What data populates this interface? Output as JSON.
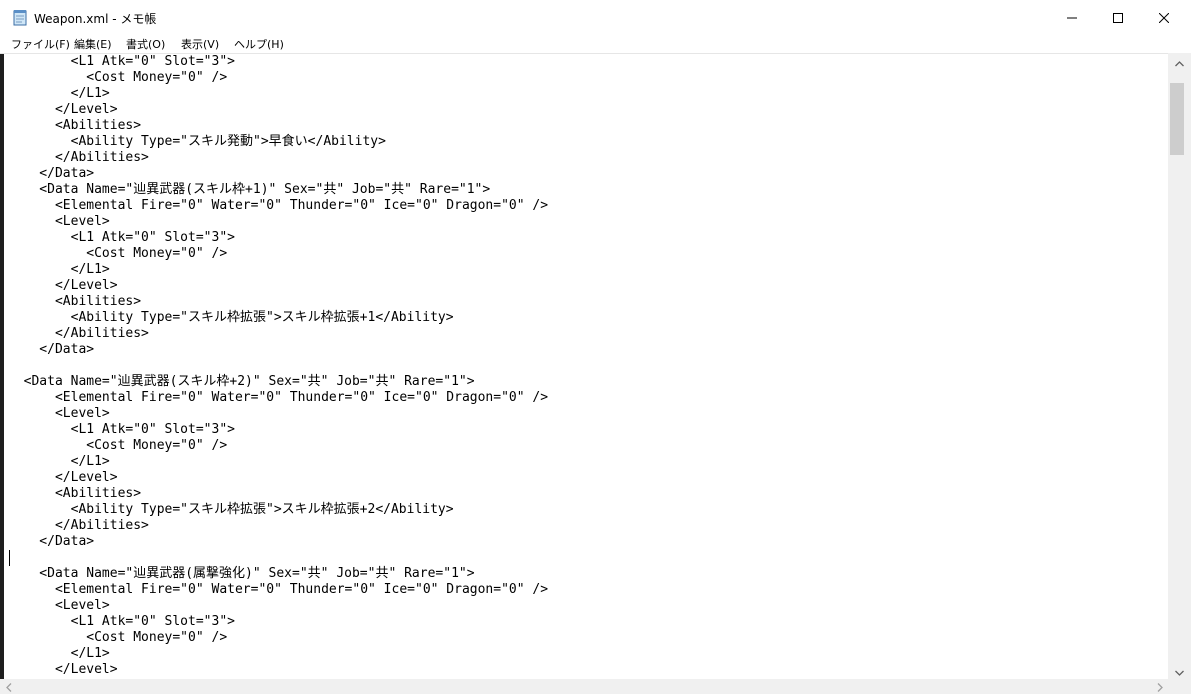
{
  "window": {
    "title": "Weapon.xml - メモ帳",
    "icon": "notepad-icon",
    "controls": {
      "minimize": "minimize-icon",
      "maximize": "maximize-icon",
      "close": "close-icon"
    }
  },
  "menu": {
    "file": "ファイル(F)",
    "edit": "編集(E)",
    "format": "書式(O)",
    "view": "表示(V)",
    "help": "ヘルプ(H)"
  },
  "editor": {
    "lines": [
      "        <L1 Atk=\"0\" Slot=\"3\">",
      "          <Cost Money=\"0\" />",
      "        </L1>",
      "      </Level>",
      "      <Abilities>",
      "        <Ability Type=\"スキル発動\">早食い</Ability>",
      "      </Abilities>",
      "    </Data>",
      "    <Data Name=\"辿異武器(スキル枠+1)\" Sex=\"共\" Job=\"共\" Rare=\"1\">",
      "      <Elemental Fire=\"0\" Water=\"0\" Thunder=\"0\" Ice=\"0\" Dragon=\"0\" />",
      "      <Level>",
      "        <L1 Atk=\"0\" Slot=\"3\">",
      "          <Cost Money=\"0\" />",
      "        </L1>",
      "      </Level>",
      "      <Abilities>",
      "        <Ability Type=\"スキル枠拡張\">スキル枠拡張+1</Ability>",
      "      </Abilities>",
      "    </Data>",
      "",
      "  <Data Name=\"辿異武器(スキル枠+2)\" Sex=\"共\" Job=\"共\" Rare=\"1\">",
      "      <Elemental Fire=\"0\" Water=\"0\" Thunder=\"0\" Ice=\"0\" Dragon=\"0\" />",
      "      <Level>",
      "        <L1 Atk=\"0\" Slot=\"3\">",
      "          <Cost Money=\"0\" />",
      "        </L1>",
      "      </Level>",
      "      <Abilities>",
      "        <Ability Type=\"スキル枠拡張\">スキル枠拡張+2</Ability>",
      "      </Abilities>",
      "    </Data>",
      "",
      "    <Data Name=\"辿異武器(属撃強化)\" Sex=\"共\" Job=\"共\" Rare=\"1\">",
      "      <Elemental Fire=\"0\" Water=\"0\" Thunder=\"0\" Ice=\"0\" Dragon=\"0\" />",
      "      <Level>",
      "        <L1 Atk=\"0\" Slot=\"3\">",
      "          <Cost Money=\"0\" />",
      "        </L1>",
      "      </Level>"
    ]
  },
  "scrollbars": {
    "up": "chevron-up-icon",
    "down": "chevron-down-icon",
    "left": "chevron-left-icon",
    "right": "chevron-right-icon"
  }
}
